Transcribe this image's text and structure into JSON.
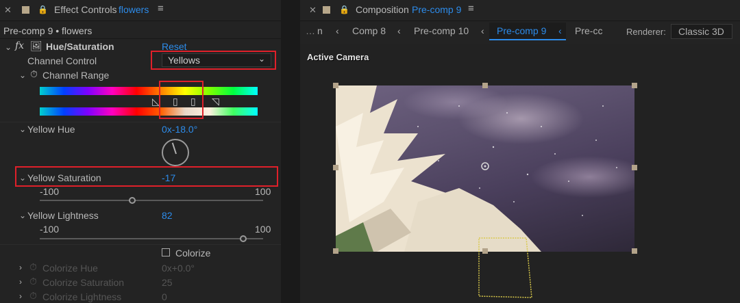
{
  "left_panel": {
    "panel_name": "Effect Controls",
    "layer": "flowers",
    "breadcrumb": "Pre-comp 9 • flowers",
    "effect": {
      "fx": "fx",
      "name": "Hue/Saturation",
      "reset": "Reset"
    },
    "channel_control": {
      "label": "Channel Control",
      "value": "Yellows"
    },
    "channel_range": {
      "label": "Channel Range"
    },
    "yellow_hue": {
      "label": "Yellow Hue",
      "value": "0x-18.0°"
    },
    "yellow_saturation": {
      "label": "Yellow Saturation",
      "value": "-17",
      "min": "-100",
      "max": "100",
      "level": 0.415
    },
    "yellow_lightness": {
      "label": "Yellow Lightness",
      "value": "82",
      "min": "-100",
      "max": "100",
      "level": 0.91
    },
    "colorize": {
      "label": "Colorize"
    },
    "colorize_hue": {
      "label": "Colorize Hue",
      "value": "0x+0.0°"
    },
    "colorize_saturation": {
      "label": "Colorize Saturation",
      "value": "25"
    },
    "colorize_lightness": {
      "label": "Colorize Lightness",
      "value": "0"
    }
  },
  "right_panel": {
    "panel_name": "Composition",
    "comp_name": "Pre-comp 9",
    "tabs": [
      "n",
      "Comp 8",
      "Pre-comp 10",
      "Pre-comp 9",
      "Pre-cc"
    ],
    "active_tab_index": 3,
    "renderer_label": "Renderer:",
    "renderer_value": "Classic 3D",
    "viewer_label": "Active Camera"
  },
  "colors": {
    "accent": "#2d8ceb",
    "highlight_box": "#e0202a",
    "motion_path": "#d8c84a"
  }
}
